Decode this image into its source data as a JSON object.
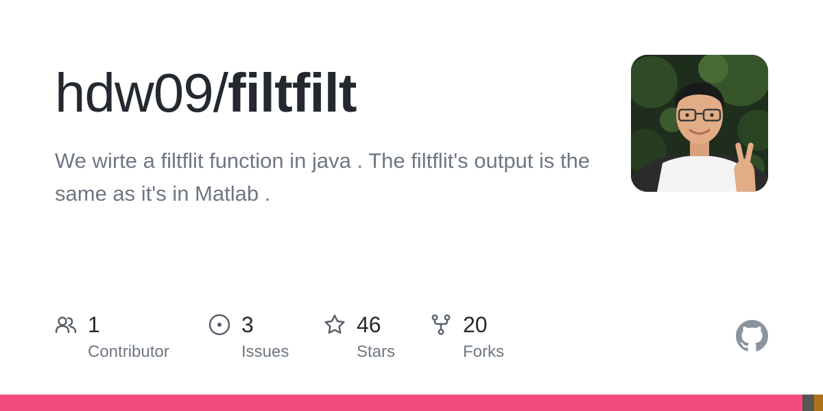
{
  "repo": {
    "owner": "hdw09",
    "separator": "/",
    "name": "filtfilt",
    "description": "We wirte a filtflit function in java . The filtflit's output is the same as it's in Matlab ."
  },
  "stats": [
    {
      "icon": "people-icon",
      "count": "1",
      "label": "Contributor"
    },
    {
      "icon": "issue-opened-icon",
      "count": "3",
      "label": "Issues"
    },
    {
      "icon": "star-icon",
      "count": "46",
      "label": "Stars"
    },
    {
      "icon": "repo-forked-icon",
      "count": "20",
      "label": "Forks"
    }
  ],
  "colors": {
    "title": "#24292f",
    "muted": "#6e7781",
    "icon": "#57606a",
    "logo": "#8c959f"
  },
  "language_bar": [
    {
      "color": "#f34b7d",
      "share": 0.975
    },
    {
      "color": "#555555",
      "share": 0.014
    },
    {
      "color": "#b07219",
      "share": 0.011
    }
  ]
}
